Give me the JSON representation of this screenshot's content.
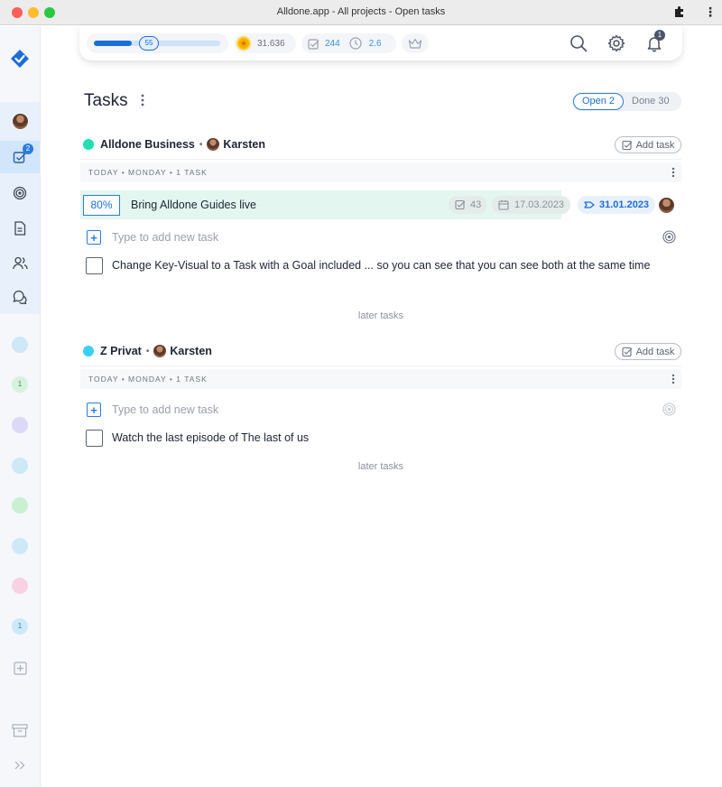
{
  "window": {
    "title": "Alldone.app - All projects - Open tasks"
  },
  "sidebar": {
    "nav_badge": "2",
    "project_badges": [
      "1",
      "1"
    ],
    "project_colors": [
      "#cde8f7",
      "#d6f2dd",
      "#dcd8f7",
      "#cde8f7",
      "#c9f0d3",
      "#cde8f7",
      "#f9d2e2",
      "#cde8f7"
    ]
  },
  "topbar": {
    "progress_value": "55",
    "progress_percent": 0.3,
    "gold": "31.636",
    "tasks_done": "244",
    "time_value": "2.6",
    "notifications": "1"
  },
  "main": {
    "title": "Tasks",
    "toggle": {
      "open_label": "Open 2",
      "done_label": "Done 30"
    }
  },
  "projects": [
    {
      "name": "Alldone Business",
      "color": "#1fe0b0",
      "owner": "Karsten",
      "add_task_label": "Add task",
      "day_label": "TODAY • MONDAY • 1 TASK",
      "highlighted_task": {
        "progress": "80%",
        "title": "Bring Alldone Guides live",
        "subtasks": "43",
        "date": "17.03.2023",
        "due": "31.01.2023"
      },
      "new_task_placeholder": "Type to add new task",
      "task": "Change Key-Visual to a Task with a Goal included ... so you can see that you can see both at the same time",
      "later_label": "later tasks"
    },
    {
      "name": "Z Privat",
      "color": "#3ad0f5",
      "owner": "Karsten",
      "add_task_label": "Add task",
      "day_label": "TODAY • MONDAY • 1 TASK",
      "new_task_placeholder": "Type to add new task",
      "task": "Watch the last episode of The last of us",
      "later_label": "later tasks"
    }
  ]
}
